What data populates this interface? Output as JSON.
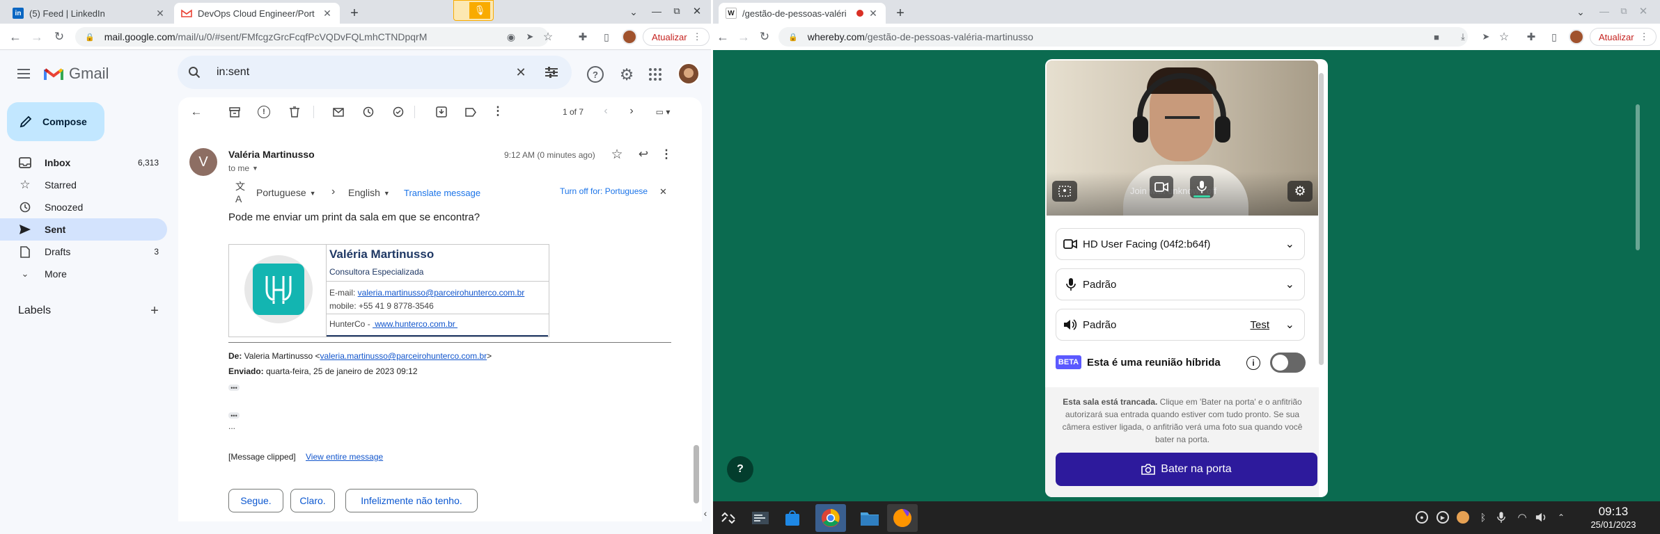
{
  "left_browser": {
    "tabs": [
      {
        "title": "(5) Feed | LinkedIn",
        "active": false
      },
      {
        "title": "DevOps Cloud Engineer/Port",
        "active": true
      }
    ],
    "url_host": "mail.google.com",
    "url_path": "/mail/u/0/#sent/FMfcgzGrcFcqfPcVQDvFQLmhCTNDpqrM",
    "update_button": "Atualizar"
  },
  "gmail": {
    "logo_text": "Gmail",
    "search_value": "in:sent",
    "compose_label": "Compose",
    "nav": [
      {
        "label": "Inbox",
        "count": "6,313",
        "icon": "inbox-icon"
      },
      {
        "label": "Starred",
        "count": "",
        "icon": "star-icon"
      },
      {
        "label": "Snoozed",
        "count": "",
        "icon": "clock-icon"
      },
      {
        "label": "Sent",
        "count": "",
        "icon": "send-icon"
      },
      {
        "label": "Drafts",
        "count": "3",
        "icon": "draft-icon"
      },
      {
        "label": "More",
        "count": "",
        "icon": "chevron-down-icon"
      }
    ],
    "labels_heading": "Labels",
    "pagination": "1 of 7",
    "message": {
      "avatar_letter": "V",
      "sender": "Valéria Martinusso",
      "to": "to me",
      "time": "9:12 AM (0 minutes ago)",
      "translate_from": "Portuguese",
      "translate_to": "English",
      "translate_link": "Translate message",
      "turn_off": "Turn off for: Portuguese",
      "body": "Pode me enviar um print da sala em que se encontra?",
      "signature": {
        "name": "Valéria Martinusso",
        "role": "Consultora Especializada",
        "email_label": "E-mail: ",
        "email": "valeria.martinusso@parceirohunterco.com.br",
        "mobile": "mobile: +55 41 9 8778-3546",
        "company": "HunterCo - ",
        "site": " www.hunterco.com.br "
      },
      "quote_from_label": "De:",
      "quote_from": " Valeria Martinusso <",
      "quote_from_email": "valeria.martinusso@parceirohunterco.com.br",
      "quote_from_end": ">",
      "quote_sent_label": "Enviado:",
      "quote_sent": " quarta-feira, 25 de janeiro de 2023 09:12",
      "ellipsis": "...",
      "clipped": "[Message clipped]",
      "view_entire": "View entire message",
      "smart_replies": [
        "Segue.",
        "Claro.",
        "Infelizmente não tenho."
      ]
    }
  },
  "right_browser": {
    "tab_title": "/gestão-de-pessoas-valéri",
    "url_host": "whereby.com",
    "url_path": "/gestão-de-pessoas-valéria-martinusso",
    "update_button": "Atualizar"
  },
  "whereby": {
    "video_overlay": "Join with unknown off",
    "camera_device": "HD User Facing (04f2:b64f)",
    "mic_device": "Padrão",
    "speaker_device": "Padrão",
    "test_label": "Test",
    "beta_badge": "BETA",
    "hybrid_label": "Esta é uma reunião híbrida",
    "hybrid_on": false,
    "locked_bold": "Esta sala está trancada.",
    "locked_text": " Clique em 'Bater na porta' e o anfitrião autorizará sua entrada quando estiver com tudo pronto. Se sua câmera estiver ligada, o anfitrião verá uma foto sua quando você bater na porta.",
    "knock_button": "Bater na porta",
    "help": "?"
  },
  "taskbar": {
    "time": "09:13",
    "date": "25/01/2023"
  },
  "colors": {
    "gmail_sidebar_selected": "#d3e3fd",
    "compose_bg": "#c2e7ff",
    "whereby_bg": "#0b6b50",
    "knock_button": "#2d1a9c",
    "teal_logo": "#13b5b1"
  }
}
